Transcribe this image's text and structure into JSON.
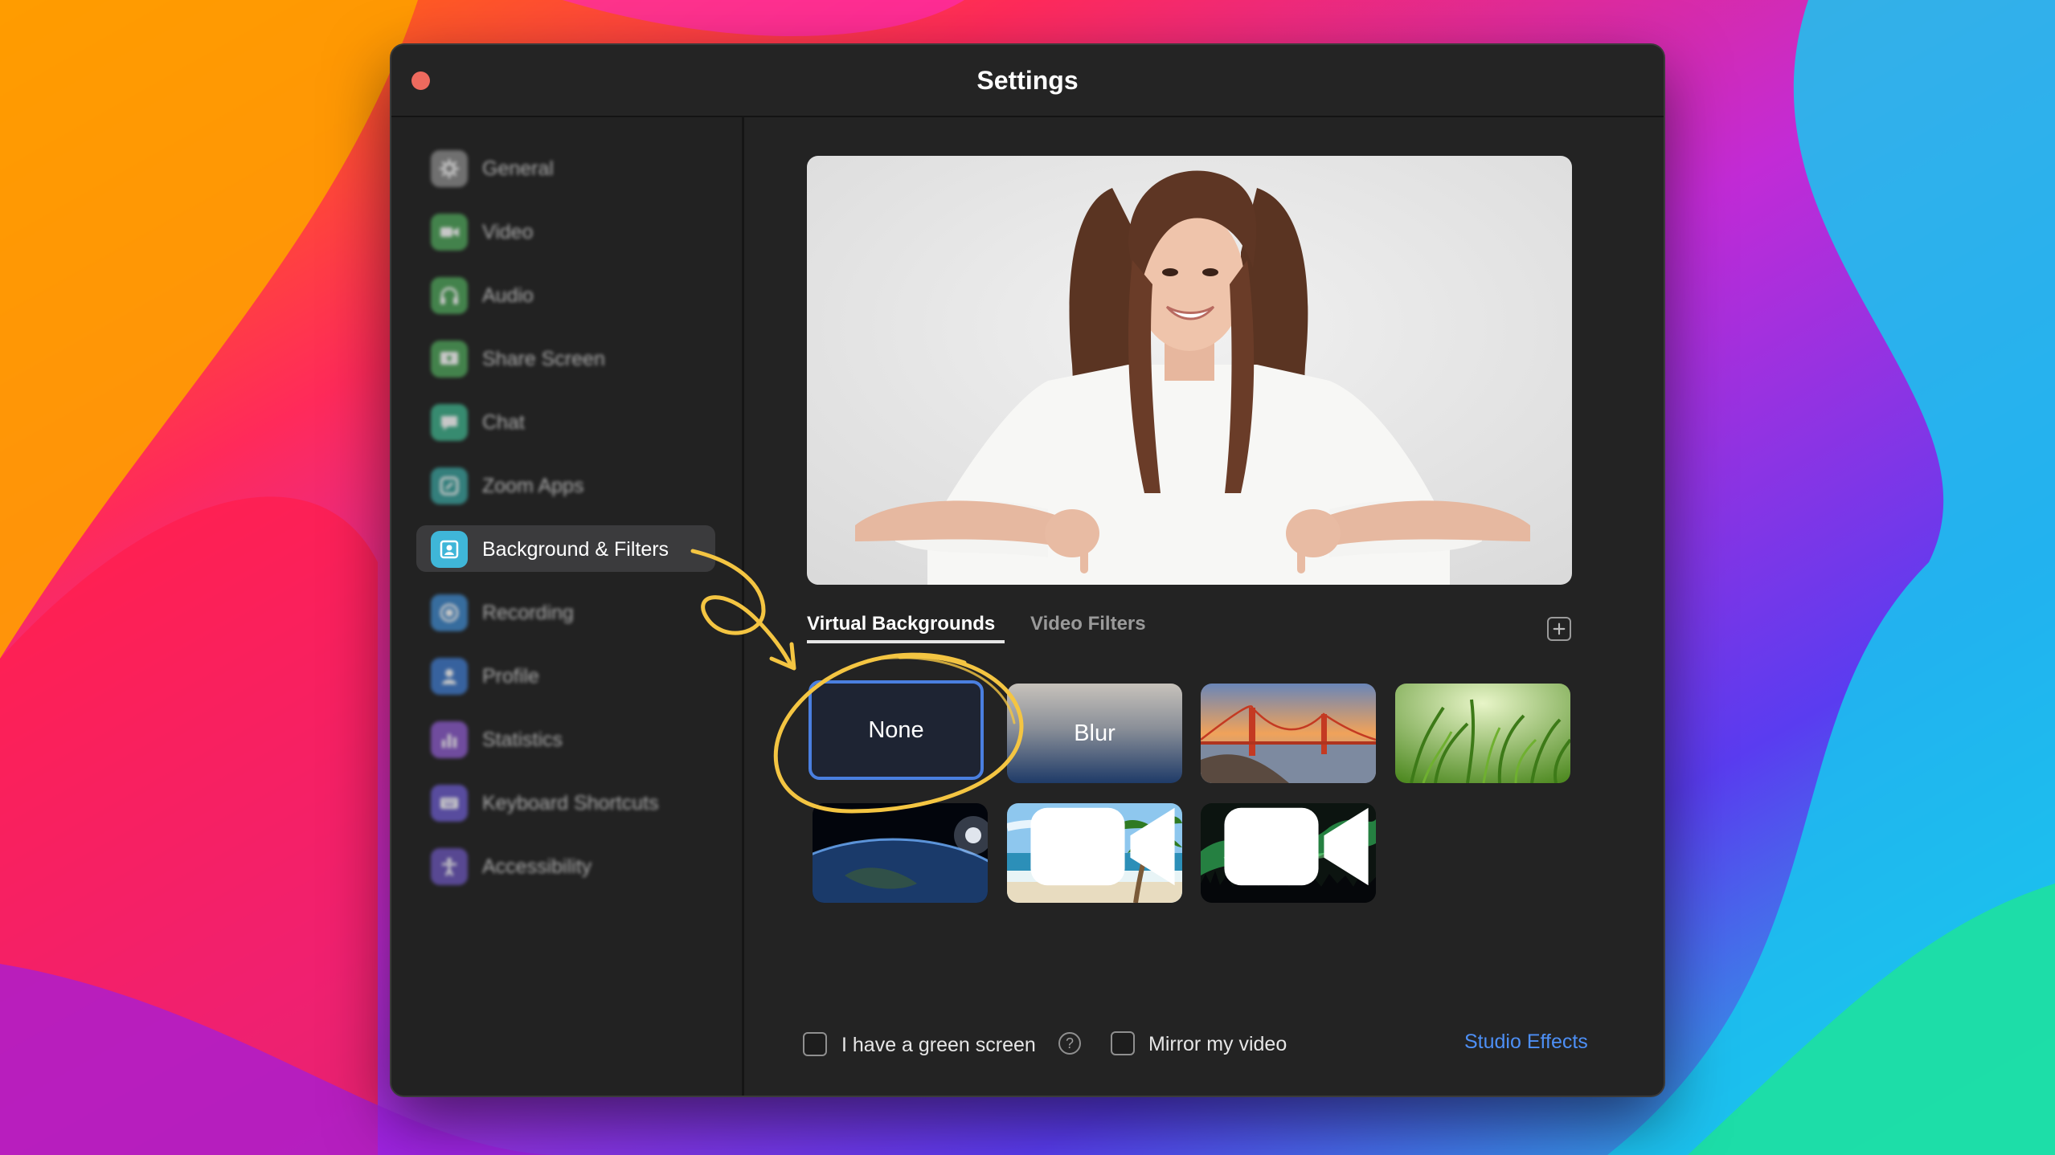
{
  "window": {
    "title": "Settings"
  },
  "sidebar": {
    "items": [
      {
        "label": "General",
        "icon": "gear-icon",
        "color": "#8a8a8a"
      },
      {
        "label": "Video",
        "icon": "video-camera-icon",
        "color": "#4fa35a"
      },
      {
        "label": "Audio",
        "icon": "headphones-icon",
        "color": "#4fa35a"
      },
      {
        "label": "Share Screen",
        "icon": "share-screen-icon",
        "color": "#4fa35a"
      },
      {
        "label": "Chat",
        "icon": "chat-bubble-icon",
        "color": "#3fae8a"
      },
      {
        "label": "Zoom Apps",
        "icon": "apps-icon",
        "color": "#3a9e9a"
      },
      {
        "label": "Background & Filters",
        "icon": "person-portrait-icon",
        "color": "#3fb6d8"
      },
      {
        "label": "Recording",
        "icon": "record-icon",
        "color": "#3f86c8"
      },
      {
        "label": "Profile",
        "icon": "profile-icon",
        "color": "#3f78c8"
      },
      {
        "label": "Statistics",
        "icon": "bar-chart-icon",
        "color": "#8a5ac8"
      },
      {
        "label": "Keyboard Shortcuts",
        "icon": "keyboard-icon",
        "color": "#6a5ac8"
      },
      {
        "label": "Accessibility",
        "icon": "accessibility-icon",
        "color": "#6a55b8"
      }
    ],
    "active_index": 6
  },
  "tabs": {
    "virtual": "Virtual Backgrounds",
    "filters": "Video Filters"
  },
  "backgrounds": {
    "none_label": "None",
    "blur_label": "Blur",
    "images": [
      "golden-gate-bridge",
      "grass",
      "earth-from-space",
      "beach-palm",
      "aurora"
    ]
  },
  "options": {
    "green_screen": "I have a green screen",
    "help": "?",
    "mirror": "Mirror my video",
    "studio": "Studio Effects"
  },
  "accent_color": "#4a7fe0",
  "annotation_color": "#f4c542"
}
